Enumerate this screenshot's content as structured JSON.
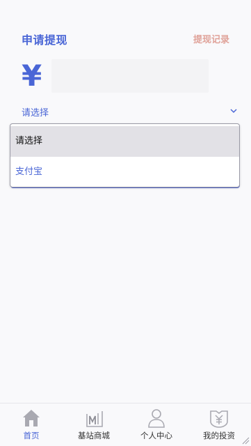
{
  "header": {
    "title": "申请提现",
    "records_link": "提现记录"
  },
  "amount": {
    "currency_symbol": "¥",
    "value": "",
    "placeholder": ""
  },
  "method_select": {
    "selected": "请选择",
    "options": [
      "请选择",
      "支付宝"
    ],
    "highlighted_index": 0
  },
  "tabbar": {
    "items": [
      {
        "label": "首页",
        "icon": "home-icon",
        "active": true
      },
      {
        "label": "基站商城",
        "icon": "mall-icon",
        "active": false
      },
      {
        "label": "个人中心",
        "icon": "person-icon",
        "active": false
      },
      {
        "label": "我的投资",
        "icon": "investment-icon",
        "active": false
      }
    ]
  },
  "colors": {
    "accent": "#4a66d6",
    "records_link": "#e0a39a",
    "tab_icon": "#b0b0b8",
    "option_highlight": "#e2e1e6"
  }
}
